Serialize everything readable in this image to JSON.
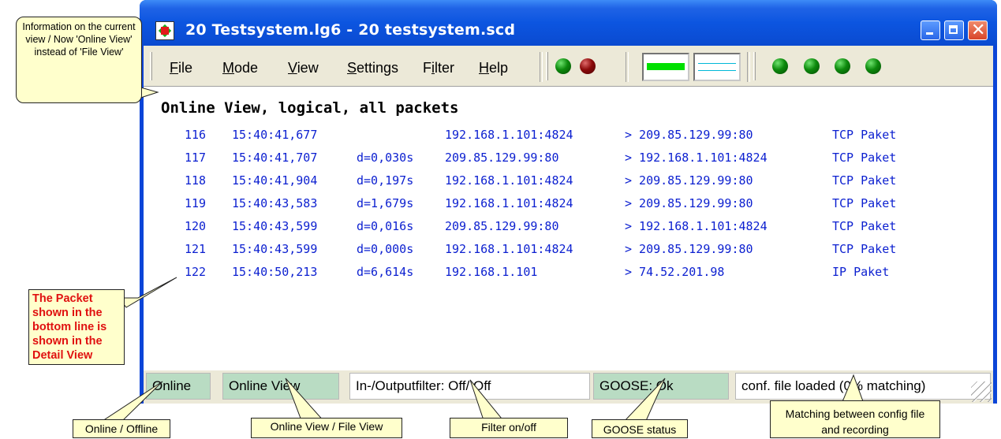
{
  "window": {
    "title": "20 Testsystem.lg6 - 20 testsystem.scd",
    "min_icon": "minimize-icon",
    "max_icon": "maximize-icon",
    "close_icon": "close-icon",
    "close_glyph": "✕"
  },
  "menu": {
    "items": [
      {
        "first": "F",
        "rest": "ile"
      },
      {
        "first": "M",
        "rest": "ode"
      },
      {
        "first": "V",
        "rest": "iew"
      },
      {
        "first": "S",
        "rest": "ettings"
      },
      {
        "pre": "F",
        "ul": "i",
        "post": "lter"
      },
      {
        "first": "H",
        "rest": "elp"
      }
    ]
  },
  "toolbar": {
    "leds_left": [
      "green",
      "red"
    ],
    "leds_right": [
      "green",
      "green",
      "green",
      "green"
    ],
    "colors": {
      "green": "#0d8a0d",
      "red": "#8c0a0a",
      "bar": "#00e000",
      "bar_line": "#00b8d8"
    }
  },
  "view_title": "Online View, logical, all packets",
  "packets": [
    {
      "no": "116",
      "time": "15:40:41,677",
      "delta": "",
      "src": "192.168.1.101:4824",
      "dst": "> 209.85.129.99:80",
      "type": "TCP Paket"
    },
    {
      "no": "117",
      "time": "15:40:41,707",
      "delta": "d=0,030s",
      "src": "209.85.129.99:80",
      "dst": "> 192.168.1.101:4824",
      "type": "TCP Paket"
    },
    {
      "no": "118",
      "time": "15:40:41,904",
      "delta": "d=0,197s",
      "src": "192.168.1.101:4824",
      "dst": "> 209.85.129.99:80",
      "type": "TCP Paket"
    },
    {
      "no": "119",
      "time": "15:40:43,583",
      "delta": "d=1,679s",
      "src": "192.168.1.101:4824",
      "dst": "> 209.85.129.99:80",
      "type": "TCP Paket"
    },
    {
      "no": "120",
      "time": "15:40:43,599",
      "delta": "d=0,016s",
      "src": "209.85.129.99:80",
      "dst": "> 192.168.1.101:4824",
      "type": "TCP Paket"
    },
    {
      "no": "121",
      "time": "15:40:43,599",
      "delta": "d=0,000s",
      "src": "192.168.1.101:4824",
      "dst": "> 209.85.129.99:80",
      "type": "TCP Paket"
    },
    {
      "no": "122",
      "time": "15:40:50,213",
      "delta": "d=6,614s",
      "src": "192.168.1.101",
      "dst": "> 74.52.201.98",
      "type": "IP Paket"
    }
  ],
  "status": {
    "online": "Online",
    "view": "Online View",
    "filter": "In-/Outputfilter: Off/ Off",
    "goose": "GOOSE: Ok",
    "conf": "conf. file loaded (0% matching)",
    "colors": {
      "panel_green": "#b9dcc3"
    }
  },
  "callouts": {
    "info": "Information on the current view / Now 'Online View' instead of 'File View'",
    "packet": "The Packet shown in the bottom line is shown in the Detail View",
    "online_offline": "Online / Offline",
    "online_file": "Online View / File View",
    "filter": "Filter on/off",
    "goose": "GOOSE status",
    "matching": "Matching between config file and recording"
  }
}
